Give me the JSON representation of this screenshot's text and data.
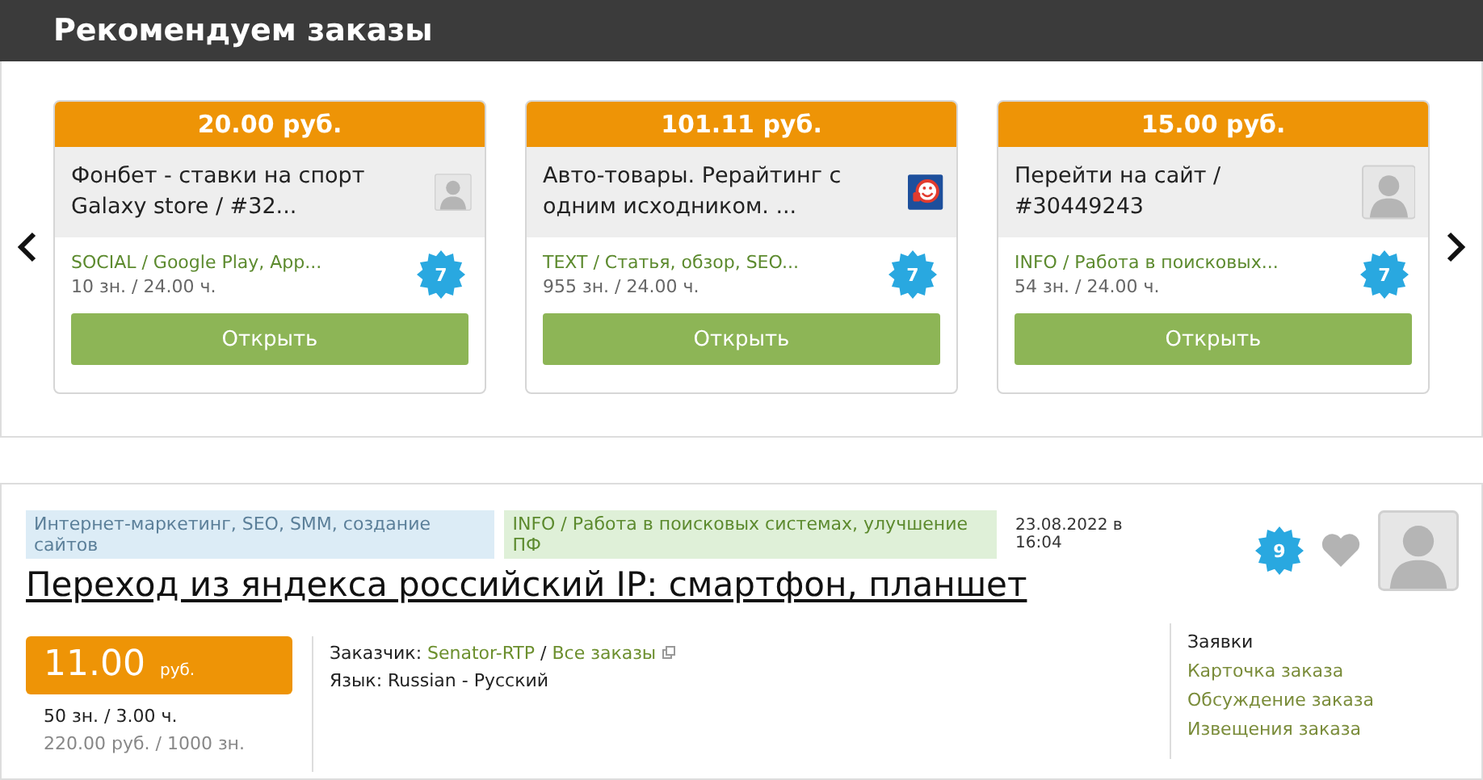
{
  "header": {
    "title": "Рекомендуем заказы"
  },
  "recommended": [
    {
      "price": "20.00 руб.",
      "title": "Фонбет - ставки на спорт Galaxy store / #32...",
      "avatar": {
        "kind": "person"
      },
      "category": "SOCIAL / Google Play, App...",
      "terms": "10 зн. / 24.00 ч.",
      "badge": "7",
      "button": "Открыть"
    },
    {
      "price": "101.11 руб.",
      "title": "Авто-товары. Рерайтинг с одним исходником. ...",
      "avatar": {
        "kind": "logo"
      },
      "category": "TEXT / Статья, обзор, SEO...",
      "terms": "955 зн. / 24.00 ч.",
      "badge": "7",
      "button": "Открыть"
    },
    {
      "price": "15.00 руб.",
      "title": "Перейти на сайт / #30449243",
      "avatar": {
        "kind": "person"
      },
      "category": "INFO / Работа в поисковых...",
      "terms": "54 зн. / 24.00 ч.",
      "badge": "7",
      "button": "Открыть"
    }
  ],
  "order": {
    "tags": [
      {
        "text": "Интернет-маркетинг, SEO, SMM, создание сайтов",
        "color": "#dcecf6"
      },
      {
        "text": "INFO / Работа в поисковых системах, улучшение ПФ",
        "color": "#dff0d8"
      }
    ],
    "date": "23.08.2022 в 16:04",
    "title": "Переход из яндекса российский IP: смартфон, планшет",
    "badge": "9",
    "price": "11.00",
    "currency": "руб.",
    "terms": "50 зн. / 3.00 ч.",
    "rate": "220.00 руб. / 1000 зн.",
    "customer_label": "Заказчик:",
    "customer": "Senator-RTP",
    "separator": "/",
    "all_orders": "Все заказы",
    "language_label": "Язык:",
    "language": "Russian - Русский",
    "links": [
      {
        "text": "Заявки",
        "selected": true
      },
      {
        "text": "Карточка заказа",
        "selected": false
      },
      {
        "text": "Обсуждение заказа",
        "selected": false
      },
      {
        "text": "Извещения заказа",
        "selected": false
      }
    ]
  }
}
